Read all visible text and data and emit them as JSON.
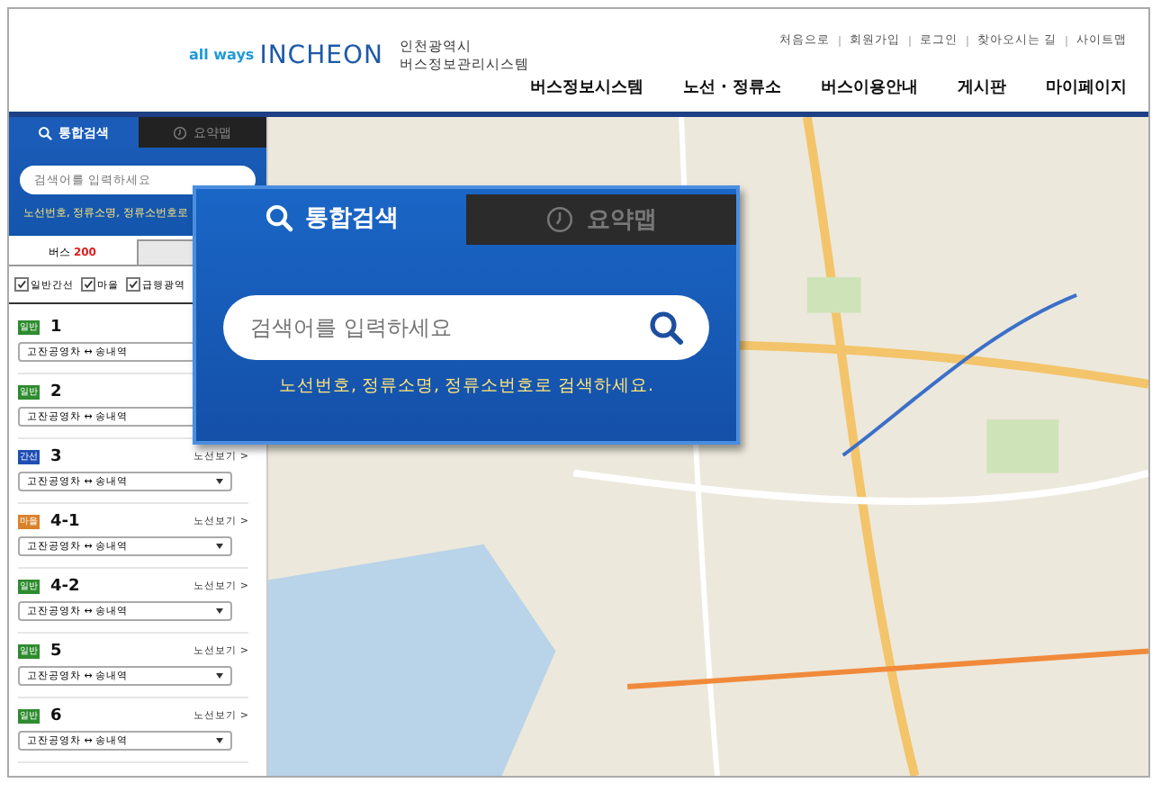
{
  "header": {
    "logo": {
      "tagline": "all ways",
      "brand": "INCHEON"
    },
    "org": [
      "인천광역시",
      "버스정보관리시스템"
    ],
    "top_links": [
      "처음으로",
      "회원가입",
      "로그인",
      "찾아오시는 길",
      "사이트맵"
    ],
    "nav": [
      "버스정보시스템",
      "노선 · 정류소",
      "버스이용안내",
      "게시판",
      "마이페이지"
    ]
  },
  "sidebar": {
    "tabs": [
      {
        "label": "통합검색",
        "selected": true
      },
      {
        "label": "요약맵",
        "selected": false
      }
    ],
    "search": {
      "placeholder": "검색어를 입력하세요"
    },
    "hint": "노선번호, 정류소명, 정류소번호로",
    "result_tab": "버스 **200**",
    "filters": [
      {
        "label": "일반간선",
        "checked": true
      },
      {
        "label": "마을",
        "checked": true
      },
      {
        "label": "급행광역",
        "checked": true
      }
    ],
    "routes": [
      {
        "badge": "일반",
        "color": "#2e8b2e",
        "number": "1",
        "direction": "고잔공영차 ↔ 송내역"
      },
      {
        "badge": "일반",
        "color": "#2e8b2e",
        "number": "2",
        "direction": "고잔공영차 ↔ 송내역"
      },
      {
        "badge": "간선",
        "color": "#1f4fb4",
        "number": "3",
        "link": "노선보기 >",
        "direction": "고잔공영차 ↔ 송내역"
      },
      {
        "badge": "마을",
        "color": "#d9822b",
        "number": "4-1",
        "link": "노선보기 >",
        "direction": "고잔공영차 ↔ 송내역"
      },
      {
        "badge": "일반",
        "color": "#2e8b2e",
        "number": "4-2",
        "link": "노선보기 >",
        "direction": "고잔공영차 ↔ 송내역"
      },
      {
        "badge": "일반",
        "color": "#2e8b2e",
        "number": "5",
        "link": "노선보기 >",
        "direction": "고잔공영차 ↔ 송내역"
      },
      {
        "badge": "일반",
        "color": "#2e8b2e",
        "number": "6",
        "link": "노선보기 >",
        "direction": "고잔공영차 ↔ 송내역"
      }
    ]
  },
  "popup": {
    "tabs": [
      {
        "label": "통합검색",
        "selected": true
      },
      {
        "label": "요약맵",
        "selected": false
      }
    ],
    "search": {
      "placeholder": "검색어를 입력하세요"
    },
    "hint": "노선번호, 정류소명, 정류소번호로 검색하세요."
  }
}
